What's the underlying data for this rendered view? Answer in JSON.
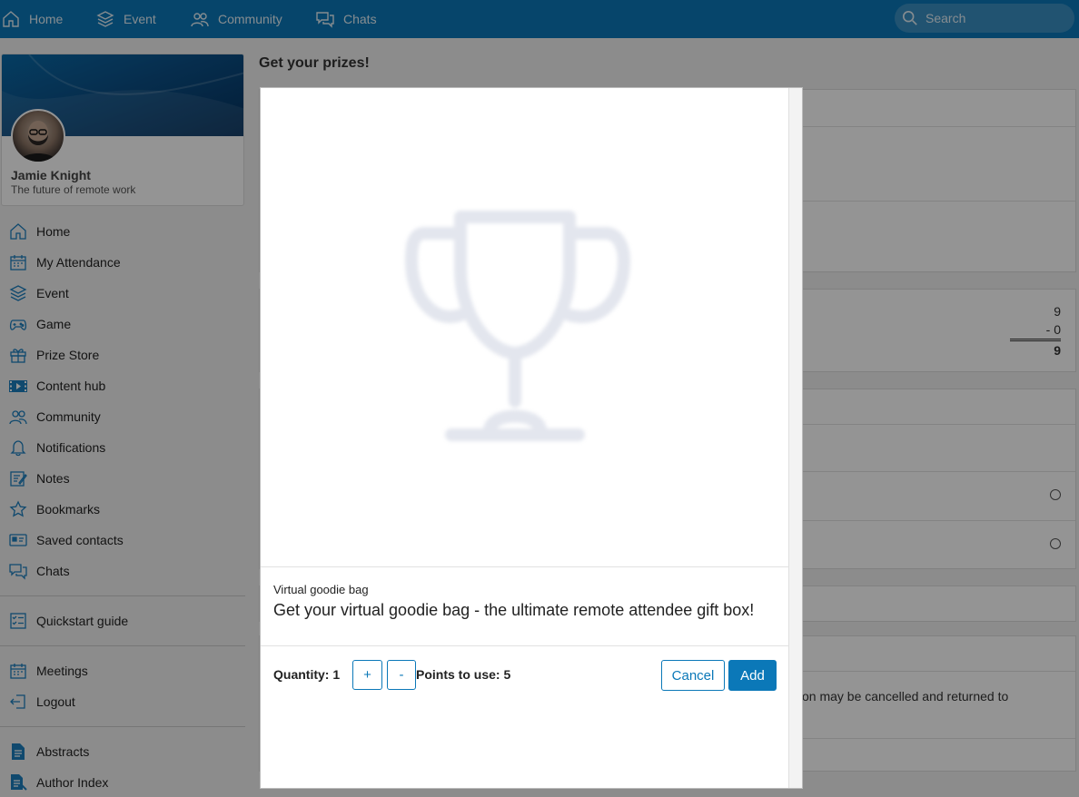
{
  "topnav": {
    "home": "Home",
    "event": "Event",
    "community": "Community",
    "chats": "Chats",
    "search_placeholder": "Search"
  },
  "profile": {
    "name": "Jamie Knight",
    "tagline": "The future of remote work"
  },
  "sidebar": {
    "items": [
      {
        "label": "Home",
        "icon": "home-icon"
      },
      {
        "label": "My Attendance",
        "icon": "calendar-icon"
      },
      {
        "label": "Event",
        "icon": "layers-icon"
      },
      {
        "label": "Game",
        "icon": "gamepad-icon"
      },
      {
        "label": "Prize Store",
        "icon": "gift-icon"
      },
      {
        "label": "Content hub",
        "icon": "video-icon"
      },
      {
        "label": "Community",
        "icon": "people-icon"
      },
      {
        "label": "Notifications",
        "icon": "bell-icon"
      },
      {
        "label": "Notes",
        "icon": "notes-icon"
      },
      {
        "label": "Bookmarks",
        "icon": "star-icon"
      },
      {
        "label": "Saved contacts",
        "icon": "contact-card-icon"
      },
      {
        "label": "Chats",
        "icon": "chat-icon"
      },
      {
        "label": "Quickstart guide",
        "icon": "checklist-icon"
      },
      {
        "label": "Meetings",
        "icon": "calendar-icon"
      },
      {
        "label": "Logout",
        "icon": "logout-icon"
      },
      {
        "label": "Abstracts",
        "icon": "document-icon"
      },
      {
        "label": "Author Index",
        "icon": "document-list-icon"
      }
    ]
  },
  "page": {
    "title": "Get your prizes!",
    "points_total": "9",
    "points_used": "- 0",
    "points_remaining": "9",
    "note_fragment": "on may be cancelled and returned to"
  },
  "modal": {
    "prize_name": "Virtual goodie bag",
    "prize_description": "Get your virtual goodie bag - the ultimate remote attendee gift box!",
    "quantity_label": "Quantity: 1",
    "plus_label": "+",
    "minus_label": "-",
    "points_label": "Points to use: 5",
    "cancel_label": "Cancel",
    "add_label": "Add"
  },
  "colors": {
    "brand": "#0b78b8",
    "trophy_placeholder": "#e3e6ee"
  }
}
